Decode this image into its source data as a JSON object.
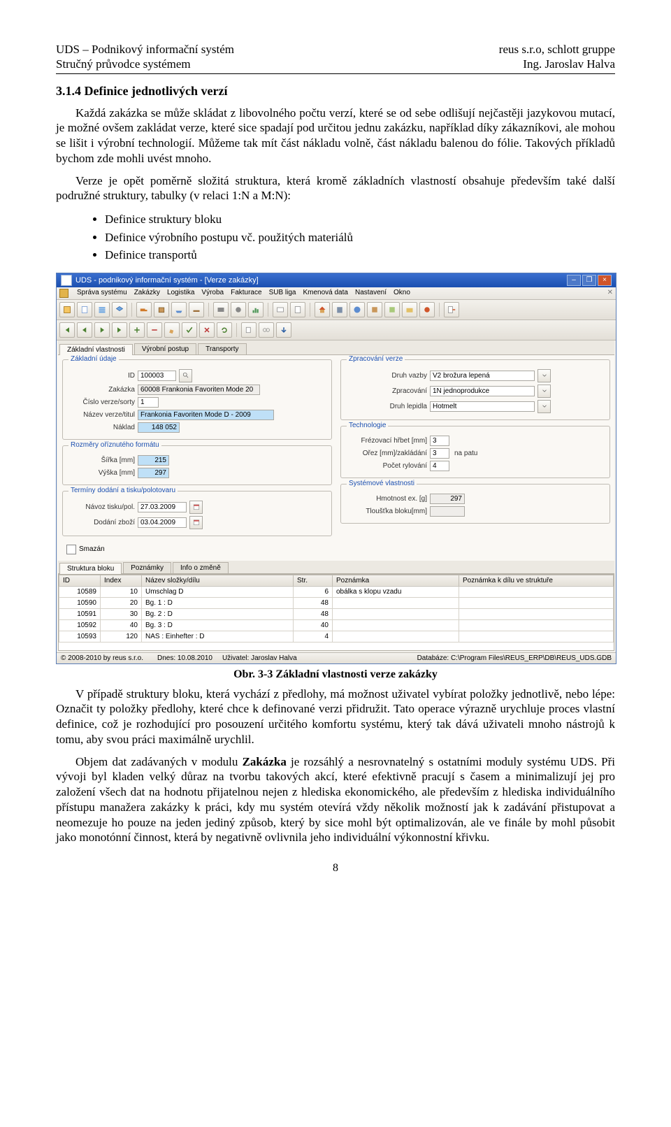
{
  "header": {
    "left1": "UDS – Podnikový informační systém",
    "left2": "Stručný průvodce systémem",
    "right1": "reus s.r.o, schlott gruppe",
    "right2": "Ing. Jaroslav Halva"
  },
  "section_heading": "3.1.4  Definice jednotlivých verzí",
  "para1": "Každá zakázka se může skládat z libovolného počtu verzí, které se od sebe odlišují nejčastěji jazykovou mutací, je možné ovšem zakládat verze, které sice spadají pod určitou jednu zakázku, například díky zákazníkovi, ale mohou se lišit i výrobní technologií. Můžeme tak mít část nákladu volně, část nákladu balenou do fólie. Takových příkladů bychom zde mohli uvést mnoho.",
  "para2": "Verze je opět poměrně složitá struktura, která kromě základních vlastností obsahuje především také další podružné struktury, tabulky (v relaci 1:N a M:N):",
  "bullets": [
    "Definice struktury bloku",
    "Definice výrobního postupu vč. použitých materiálů",
    "Definice transportů"
  ],
  "caption": "Obr. 3-3 Základní vlastnosti verze zakázky",
  "para3": "V případě struktury bloku, která vychází z předlohy, má možnost uživatel vybírat položky jednotlivě, nebo lépe: Označit ty položky předlohy,  které chce k definované verzi přidružit. Tato operace výrazně urychluje proces vlastní definice, což je rozhodující pro posouzení určitého komfortu systému, který tak dává uživateli mnoho nástrojů k tomu, aby svou práci maximálně urychlil.",
  "para4": "Objem dat zadávaných v modulu Zakázka je rozsáhlý a nesrovnatelný s ostatními moduly systému UDS. Při vývoji byl kladen velký důraz na tvorbu takových akcí, které efektivně pracují s časem a minimalizují jej pro založení všech dat na hodnotu přijatelnou nejen z hlediska ekonomického, ale především z hlediska individuálního přístupu manažera zakázky k práci, kdy mu systém otevírá vždy několik možností jak k zadávání přistupovat a neomezuje ho pouze na jeden jediný způsob, který by sice mohl být optimalizován, ale ve finále by mohl působit jako monotónní činnost, která by negativně ovlivnila jeho individuální výkonnostní křivku.",
  "page_number": "8",
  "shot": {
    "title": "UDS - podnikový informační systém - [Verze zakázky]",
    "menu": [
      "Správa systému",
      "Zakázky",
      "Logistika",
      "Výroba",
      "Fakturace",
      "SUB liga",
      "Kmenová data",
      "Nastavení",
      "Okno"
    ],
    "tabs_top": [
      "Základní vlastnosti",
      "Výrobní postup",
      "Transporty"
    ],
    "tabs_bottom": [
      "Struktura bloku",
      "Poznámky",
      "Info o změně"
    ],
    "groups": {
      "zaklad": {
        "legend": "Základní údaje",
        "id_lbl": "ID",
        "id_val": "100003",
        "zak_lbl": "Zakázka",
        "zak_val": "60008  Frankonia Favoriten Mode 20",
        "cislo_lbl": "Číslo verze/sorty",
        "cislo_val": "1",
        "nazev_lbl": "Název verze/titul",
        "nazev_val": "Frankonia Favoriten Mode D - 2009",
        "naklad_lbl": "Náklad",
        "naklad_val": "148 052"
      },
      "rozmery": {
        "legend": "Rozměry oříznutého formátu",
        "sirka_lbl": "Šířka [mm]",
        "sirka_val": "215",
        "vyska_lbl": "Výška [mm]",
        "vyska_val": "297"
      },
      "terminy": {
        "legend": "Termíny dodání a tisku/polotovaru",
        "navoz_lbl": "Návoz tisku/pol.",
        "navoz_val": "27.03.2009",
        "dodani_lbl": "Dodání zboží",
        "dodani_val": "03.04.2009"
      },
      "zprac": {
        "legend": "Zpracování verze",
        "vazba_lbl": "Druh vazby",
        "vazba_val": "V2 brožura lepená",
        "zprac_lbl": "Zpracování",
        "zprac_val": "1N jednoprodukce",
        "lep_lbl": "Druh lepidla",
        "lep_val": "Hotmelt"
      },
      "tech": {
        "legend": "Technologie",
        "frez_lbl": "Frézovací hřbet [mm]",
        "frez_val": "3",
        "orez_lbl": "Ořez [mm]/zakládání",
        "orez_val": "3",
        "orez_suffix": "na patu",
        "ryl_lbl": "Počet rylování",
        "ryl_val": "4"
      },
      "sys": {
        "legend": "Systémové vlastnosti",
        "hmot_lbl": "Hmotnost ex. [g]",
        "hmot_val": "297",
        "tloust_lbl": "Tloušťka bloku[mm]",
        "tloust_val": ""
      },
      "smazan": "Smazán"
    },
    "grid": {
      "headers": [
        "ID",
        "Index",
        "Název složky/dílu",
        "Str.",
        "Poznámka",
        "Poznámka k dílu ve struktuře"
      ],
      "rows": [
        [
          "10589",
          "10",
          "Umschlag D",
          "6",
          "obálka s klopu vzadu",
          ""
        ],
        [
          "10590",
          "20",
          "Bg. 1 : D",
          "48",
          "",
          ""
        ],
        [
          "10591",
          "30",
          "Bg. 2 : D",
          "48",
          "",
          ""
        ],
        [
          "10592",
          "40",
          "Bg. 3 : D",
          "40",
          "",
          ""
        ],
        [
          "10593",
          "120",
          "NAS : Einhefter : D",
          "4",
          "",
          ""
        ]
      ]
    },
    "status": {
      "left": "© 2008-2010 by reus s.r.o.",
      "mid1": "Dnes: 10.08.2010",
      "mid2": "Uživatel: Jaroslav Halva",
      "right": "Databáze: C:\\Program Files\\REUS_ERP\\DB\\REUS_UDS.GDB"
    }
  }
}
